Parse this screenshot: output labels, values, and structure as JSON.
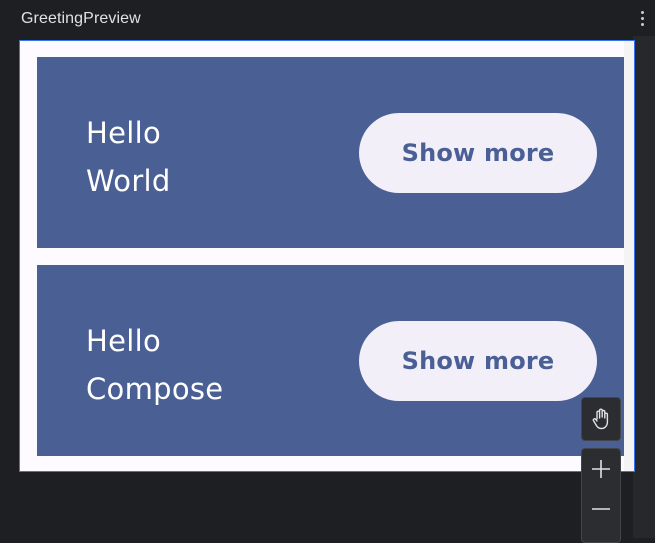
{
  "header": {
    "title": "GreetingPreview",
    "menu_icon": "more-vertical-icon"
  },
  "preview": {
    "cards": [
      {
        "greeting_line1": "Hello",
        "greeting_line2": "World",
        "button_label": "Show more"
      },
      {
        "greeting_line1": "Hello",
        "greeting_line2": "Compose",
        "button_label": "Show more"
      }
    ]
  },
  "toolbar": {
    "pan_icon": "hand-icon",
    "zoom_in_icon": "plus-icon",
    "zoom_out_icon": "minus-icon"
  },
  "colors": {
    "card_background": "#4a5f94",
    "button_background": "#f2eff9",
    "selection_border": "#3574f0",
    "ide_background": "#1e1f22"
  }
}
